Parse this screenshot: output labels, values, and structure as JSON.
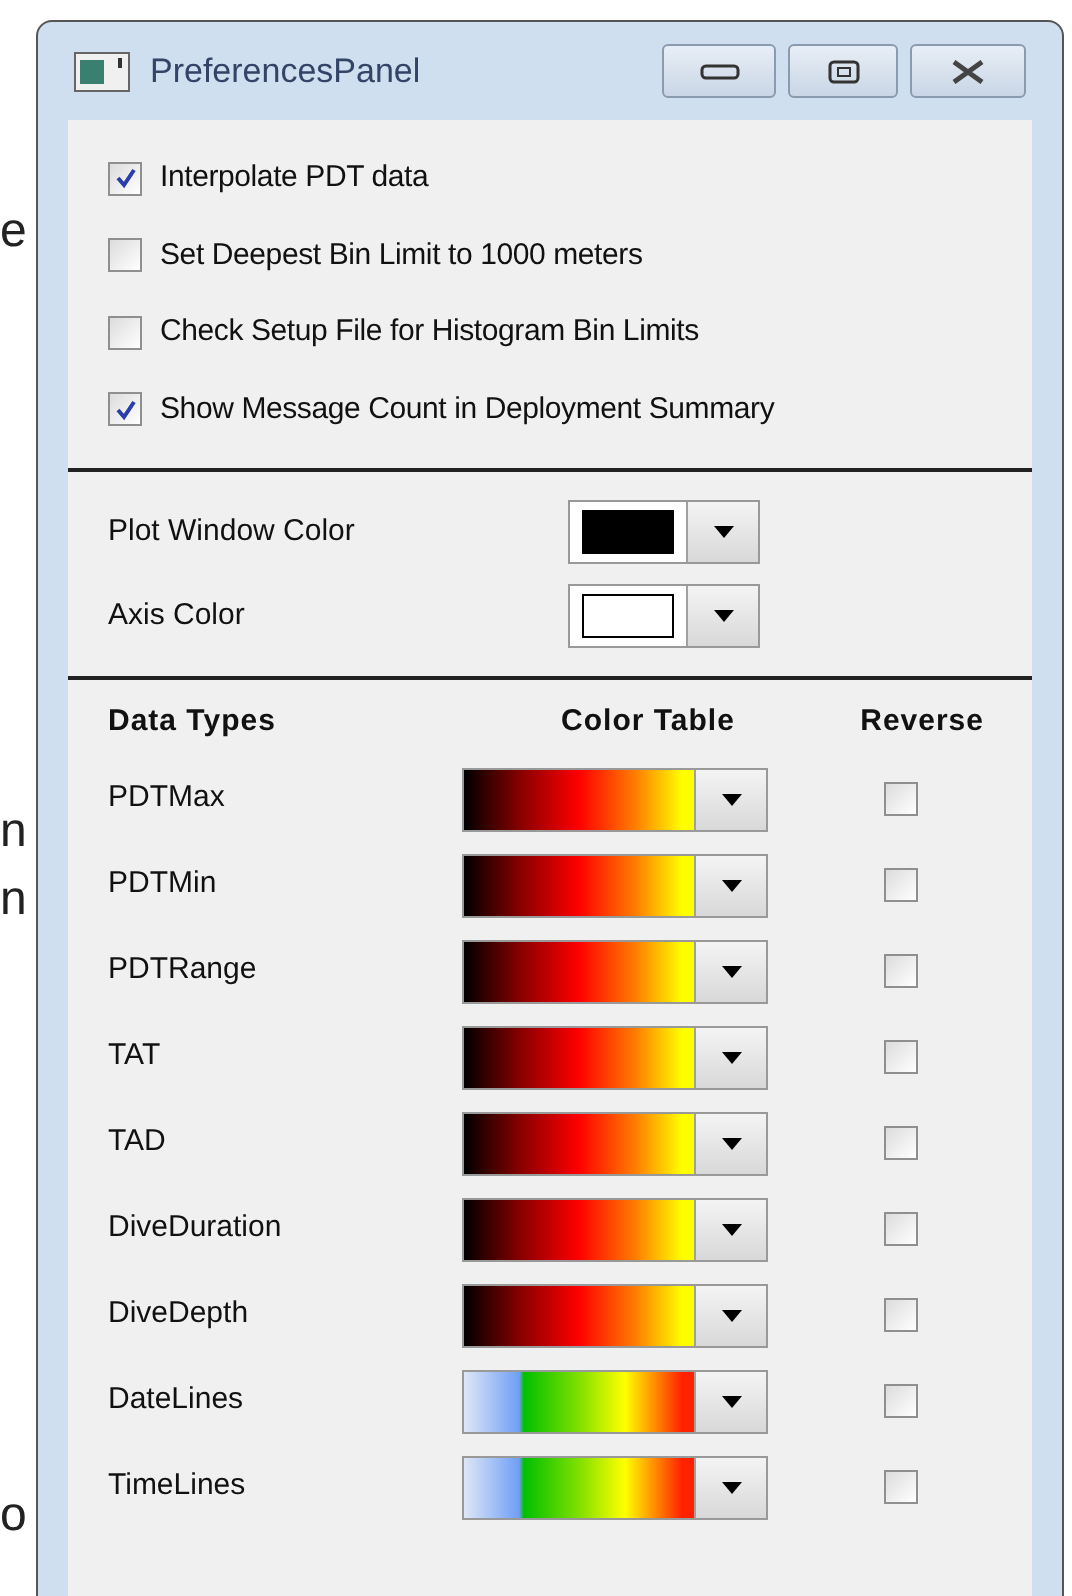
{
  "background_fragments": [
    "e",
    "n",
    "n",
    "o"
  ],
  "window": {
    "title": "PreferencesPanel"
  },
  "options": [
    {
      "label": "Interpolate PDT data",
      "checked": true
    },
    {
      "label": "Set Deepest Bin Limit to 1000 meters",
      "checked": false
    },
    {
      "label": "Check Setup File for Histogram Bin Limits",
      "checked": false
    },
    {
      "label": "Show Message Count in Deployment Summary",
      "checked": true
    }
  ],
  "colors": [
    {
      "label": "Plot Window Color",
      "color": "#000000"
    },
    {
      "label": "Axis Color",
      "color": "#ffffff"
    }
  ],
  "table": {
    "columns": [
      "Data Types",
      "Color Table",
      "Reverse"
    ],
    "rows": [
      {
        "name": "PDTMax",
        "kind": "hot",
        "reverse": false
      },
      {
        "name": "PDTMin",
        "kind": "hot",
        "reverse": false
      },
      {
        "name": "PDTRange",
        "kind": "hot",
        "reverse": false
      },
      {
        "name": "TAT",
        "kind": "hot",
        "reverse": false
      },
      {
        "name": "TAD",
        "kind": "hot",
        "reverse": false
      },
      {
        "name": "DiveDuration",
        "kind": "hot",
        "reverse": false
      },
      {
        "name": "DiveDepth",
        "kind": "hot",
        "reverse": false
      },
      {
        "name": "DateLines",
        "kind": "spectrum",
        "reverse": false
      },
      {
        "name": "TimeLines",
        "kind": "spectrum",
        "reverse": false
      }
    ]
  }
}
